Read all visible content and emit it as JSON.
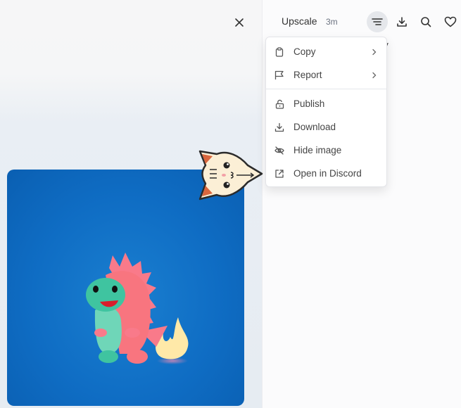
{
  "viewer": {
    "close_icon": "close-icon",
    "image_alt": "Cute pink and teal dinosaur toy with flame tail on blue background"
  },
  "header": {
    "title": "Upscale",
    "time": "3m",
    "buttons": [
      {
        "name": "options-menu-button",
        "icon": "menu-lines-icon",
        "active": true
      },
      {
        "name": "download-button",
        "icon": "download-icon"
      },
      {
        "name": "search-button",
        "icon": "search-icon"
      },
      {
        "name": "like-button",
        "icon": "heart-icon"
      }
    ]
  },
  "background_text": "py",
  "menu": {
    "items": [
      {
        "label": "Copy",
        "icon": "clipboard-icon",
        "submenu": true
      },
      {
        "label": "Report",
        "icon": "flag-icon",
        "submenu": true
      },
      {
        "label": "Publish",
        "icon": "unlock-icon",
        "submenu": false
      },
      {
        "label": "Download",
        "icon": "download-icon",
        "submenu": false
      },
      {
        "label": "Hide image",
        "icon": "eye-off-icon",
        "submenu": false
      },
      {
        "label": "Open in Discord",
        "icon": "external-link-icon",
        "submenu": false
      }
    ]
  },
  "cursor": {
    "icon": "cat-cursor-icon"
  }
}
